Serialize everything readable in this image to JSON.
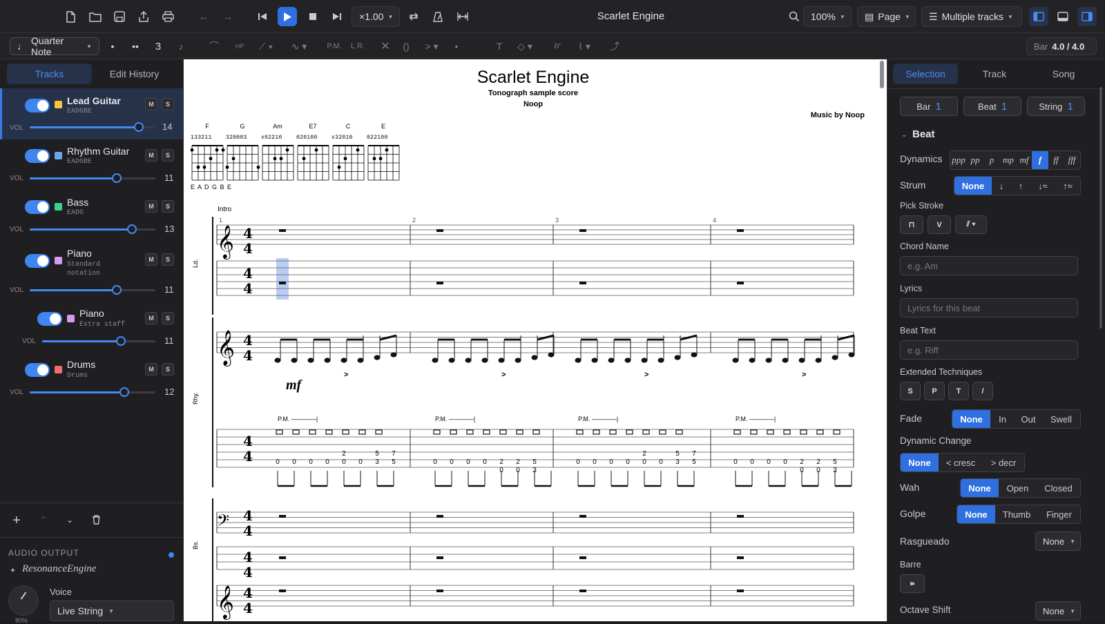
{
  "app": {
    "title": "Scarlet Engine"
  },
  "topbar": {
    "speed": "×1.00",
    "zoom": "100%",
    "layout": "Page",
    "track_mode": "Multiple tracks"
  },
  "toolbar2": {
    "duration": "Quarter Note",
    "tuplet": "3",
    "pm": "P.M.",
    "lr": "L.R.",
    "trill": "tr",
    "text_tool": "T",
    "bar_label": "Bar",
    "bar_value": "4.0 / 4.0"
  },
  "left": {
    "tabs": [
      "Tracks",
      "Edit History"
    ],
    "vol_label": "VOL",
    "tracks": [
      {
        "name": "Lead Guitar",
        "sub": "EADGBE",
        "color": "#f5c445",
        "vol": "14",
        "level": 0.88
      },
      {
        "name": "Rhythm Guitar",
        "sub": "EADGBE",
        "color": "#6fa3f0",
        "vol": "11",
        "level": 0.69
      },
      {
        "name": "Bass",
        "sub": "EADG",
        "color": "#3fcf8e",
        "vol": "13",
        "level": 0.81
      },
      {
        "name": "Piano",
        "sub": "Standard notation",
        "sub1": "Standard",
        "sub2": "notation",
        "color": "#d39bf0",
        "vol": "11",
        "level": 0.69
      },
      {
        "name": "Piano",
        "sub": "Extra staff",
        "color": "#d39bf0",
        "vol": "11",
        "level": 0.69
      },
      {
        "name": "Drums",
        "sub": "Drums",
        "color": "#ef6f6f",
        "vol": "12",
        "level": 0.75
      }
    ],
    "audio_output": "AUDIO OUTPUT",
    "engine": "ResonanceEngine",
    "voice_label": "Voice",
    "voice_value": "Live String",
    "knob_value": "80%"
  },
  "score": {
    "title": "Scarlet Engine",
    "subtitle": "Tonograph sample score",
    "artist": "Noop",
    "music_by": "Music by Noop",
    "chords": [
      "F",
      "G",
      "Am",
      "E7",
      "C",
      "E"
    ],
    "fingerings": [
      "133211",
      "320003",
      "x02210",
      "020100",
      "x32010",
      "022100"
    ],
    "tuning": "E A D G B E",
    "section": "Intro",
    "bar_numbers": [
      "1",
      "2",
      "3",
      "4"
    ],
    "track_labels": [
      "Ld.",
      "Rhy.",
      "Bs."
    ],
    "dynamic": "mf",
    "pm": "P.M.",
    "tab_bars": [
      {
        "top": [
          "",
          "",
          "",
          "",
          "2",
          "",
          "5",
          "7"
        ],
        "bottom": [
          "0",
          "0",
          "0",
          "0",
          "0",
          "0",
          "3",
          "5"
        ]
      },
      {
        "top": [
          "",
          "",
          "",
          "",
          "",
          "",
          "",
          ""
        ],
        "bottom": [
          "0",
          "0",
          "0",
          "0",
          "2",
          "2",
          "5",
          ""
        ],
        "extra": [
          "",
          "",
          "",
          "",
          "0",
          "0",
          "3",
          ""
        ]
      }
    ]
  },
  "right": {
    "tabs": [
      "Selection",
      "Track",
      "Song"
    ],
    "sel_buttons": [
      {
        "label": "Bar",
        "value": "1"
      },
      {
        "label": "Beat",
        "value": "1"
      },
      {
        "label": "String",
        "value": "1"
      }
    ],
    "section": "Beat",
    "dynamics_label": "Dynamics",
    "dynamics": [
      "ppp",
      "pp",
      "p",
      "mp",
      "mf",
      "f",
      "ff",
      "fff"
    ],
    "strum_label": "Strum",
    "strum": [
      "None",
      "↓",
      "↑",
      "↓≈",
      "↑≈"
    ],
    "pick_stroke_label": "Pick Stroke",
    "chord_name_label": "Chord Name",
    "chord_name_placeholder": "e.g. Am",
    "lyrics_label": "Lyrics",
    "lyrics_placeholder": "Lyrics for this beat",
    "beat_text_label": "Beat Text",
    "beat_text_placeholder": "e.g. Riff",
    "ext_label": "Extended Techniques",
    "ext": [
      "S",
      "P",
      "T",
      "/"
    ],
    "fade_label": "Fade",
    "fade": [
      "None",
      "In",
      "Out",
      "Swell"
    ],
    "dynchange_label": "Dynamic Change",
    "dynchange": [
      "None",
      "< cresc",
      "> decr"
    ],
    "wah_label": "Wah",
    "wah": [
      "None",
      "Open",
      "Closed"
    ],
    "golpe_label": "Golpe",
    "golpe": [
      "None",
      "Thumb",
      "Finger"
    ],
    "rasgueado_label": "Rasgueado",
    "rasgueado_value": "None",
    "barre_label": "Barre",
    "octave_label": "Octave Shift",
    "octave_value": "None"
  }
}
